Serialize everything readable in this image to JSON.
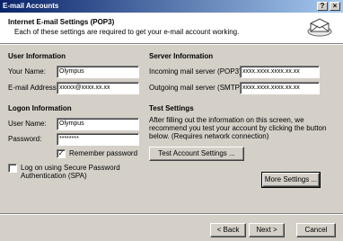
{
  "window": {
    "title": "E-mail Accounts",
    "help_glyph": "?",
    "close_glyph": "×"
  },
  "header": {
    "title": "Internet E-mail Settings (POP3)",
    "subtitle": "Each of these settings are required to get your e-mail account working.",
    "icon": "mail-envelope-icon"
  },
  "user_info": {
    "heading": "User Information",
    "name_label": "Your Name:",
    "name_value": "Olympus",
    "email_label": "E-mail Address:",
    "email_value": "xxxxx@xxxx.xx.xx"
  },
  "server_info": {
    "heading": "Server Information",
    "incoming_label": "Incoming mail server (POP3):",
    "incoming_value": "xxxx.xxxx.xxxx.xx.xx",
    "outgoing_label": "Outgoing mail server (SMTP):",
    "outgoing_value": "xxxx.xxxx.xxxx.xx.xx"
  },
  "logon_info": {
    "heading": "Logon Information",
    "username_label": "User Name:",
    "username_value": "Olympus",
    "password_label": "Password:",
    "password_value": "********",
    "remember_label": "Remember password",
    "remember_checked": true,
    "check_glyph": "✓",
    "spa_label_line1": "Log on using Secure Password",
    "spa_label_line2": "Authentication (SPA)",
    "spa_checked": false
  },
  "test_settings": {
    "heading": "Test Settings",
    "description": "After filling out the information on this screen, we recommend you test your account by clicking the button below. (Requires network connection)",
    "test_button": "Test Account Settings ...",
    "more_button": "More Settings ..."
  },
  "footer": {
    "back_button": "< Back",
    "next_button": "Next >",
    "cancel_button": "Cancel"
  }
}
